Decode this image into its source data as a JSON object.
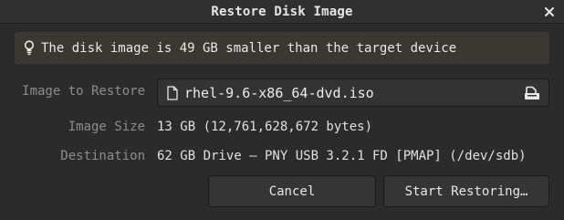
{
  "window": {
    "title": "Restore Disk Image",
    "close_glyph": "×"
  },
  "banner": {
    "icon": "lightbulb-icon",
    "text": "The disk image is 49 GB smaller than the target device"
  },
  "form": {
    "image_label": "Image to Restore",
    "image_file": "rhel-9.6-x86_64-dvd.iso",
    "size_label": "Image Size",
    "size_value": "13 GB (12,761,628,672 bytes)",
    "destination_label": "Destination",
    "destination_value": "62 GB Drive — PNY USB 3.2.1 FD [PMAP] (/dev/sdb)"
  },
  "buttons": {
    "cancel": "Cancel",
    "start": "Start Restoring…"
  },
  "colors": {
    "background": "#2b2b2b",
    "banner": "#3a3833",
    "label": "#8c8c8c",
    "text": "#e0e0e0"
  }
}
